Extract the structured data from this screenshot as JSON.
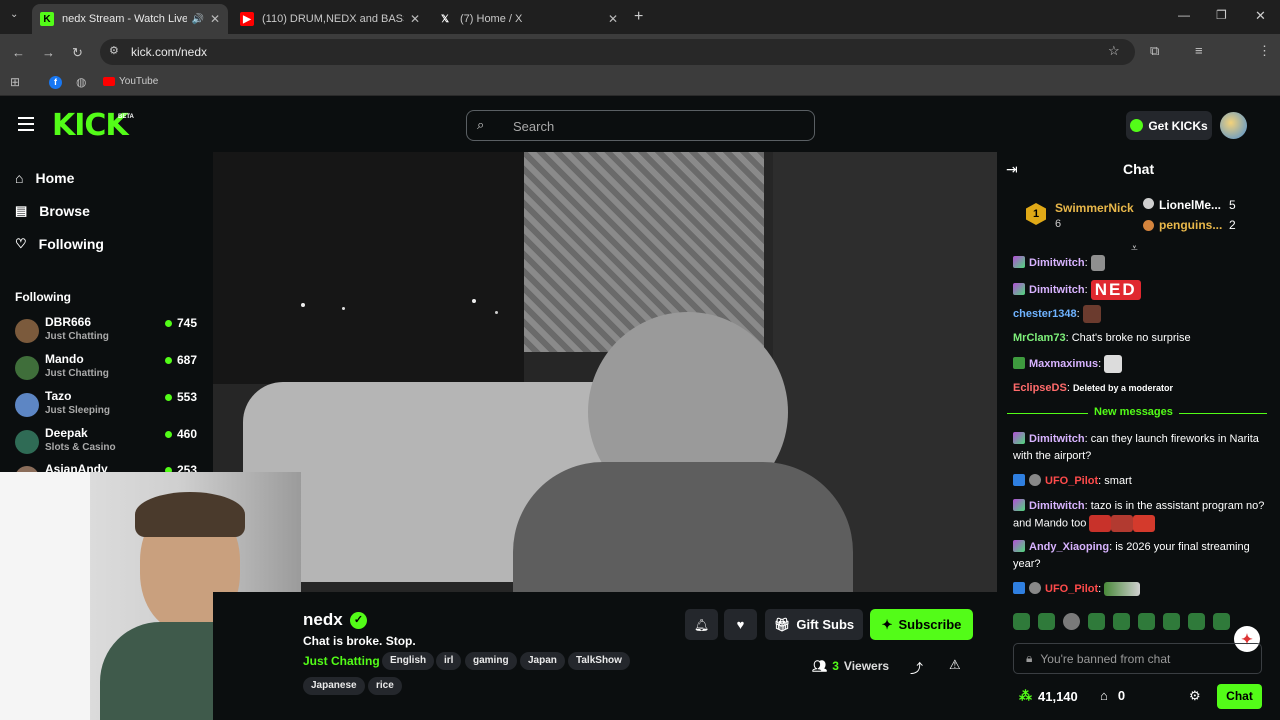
{
  "browser": {
    "tabs": [
      {
        "title": "nedx Stream - Watch Live o",
        "active": true
      },
      {
        "title": "(110) DRUM,NEDX and BASS - Y",
        "active": false
      },
      {
        "title": "(7) Home / X",
        "active": false
      }
    ],
    "url": "kick.com/nedx",
    "bookmarks": [
      {
        "label": "YouTube"
      }
    ]
  },
  "header": {
    "logo": "KICK",
    "beta": "BETA",
    "search_placeholder": "Search",
    "get_kicks": "Get KICKs"
  },
  "sidebar": {
    "nav": [
      {
        "label": "Home",
        "icon": "home-icon"
      },
      {
        "label": "Browse",
        "icon": "browse-icon"
      },
      {
        "label": "Following",
        "icon": "heart-icon"
      }
    ],
    "following_heading": "Following",
    "following": [
      {
        "name": "DBR666",
        "category": "Just Chatting",
        "viewers": "745"
      },
      {
        "name": "Mando",
        "category": "Just Chatting",
        "viewers": "687"
      },
      {
        "name": "Tazo",
        "category": "Just Sleeping",
        "viewers": "553"
      },
      {
        "name": "Deepak",
        "category": "Slots & Casino",
        "viewers": "460"
      },
      {
        "name": "AsianAndy",
        "category": "",
        "viewers": "253"
      }
    ]
  },
  "stream": {
    "channel": "nedx",
    "title": "Chat is broke. Stop.",
    "category": "Just Chatting",
    "tags": [
      "English",
      "irl",
      "gaming",
      "Japan",
      "TalkShow",
      "Japanese",
      "rice"
    ],
    "gift_subs": "Gift Subs",
    "subscribe": "Subscribe",
    "viewers": "3",
    "viewers_label": "Viewers"
  },
  "chat": {
    "title": "Chat",
    "leaderboard": [
      {
        "rank": "1",
        "name": "SwimmerNick",
        "count": "6"
      },
      {
        "name": "LionelMe...",
        "count": "5"
      },
      {
        "name": "penguins...",
        "count": "2"
      }
    ],
    "messages": [
      {
        "user": "Dimitwitch",
        "text": ""
      },
      {
        "user": "Dimitwitch",
        "text": "NED"
      },
      {
        "user": "chester1348",
        "text": ""
      },
      {
        "user": "MrClam73",
        "text": "Chat's broke no surprise"
      },
      {
        "user": "Maxmaximus",
        "text": ""
      },
      {
        "user": "EclipseDS",
        "text": "Deleted by a moderator"
      }
    ],
    "new_messages": "New messages",
    "new": [
      {
        "user": "Dimitwitch",
        "text": "can they launch fireworks in Narita with the airport?"
      },
      {
        "user": "UFO_Pilot",
        "text": "smart"
      },
      {
        "user": "Dimitwitch",
        "text": "tazo is in the assistant program no? and Mando too"
      },
      {
        "user": "Andy_Xiaoping",
        "text": "is 2026 your final streaming year?"
      },
      {
        "user": "UFO_Pilot",
        "text": ""
      }
    ],
    "banned": "You're banned from chat",
    "kicks_balance": "41,140",
    "gift_count": "0",
    "send": "Chat"
  },
  "colors": {
    "accent": "#53fc18",
    "bg": "#0b0e0f",
    "panel": "#24272c"
  }
}
